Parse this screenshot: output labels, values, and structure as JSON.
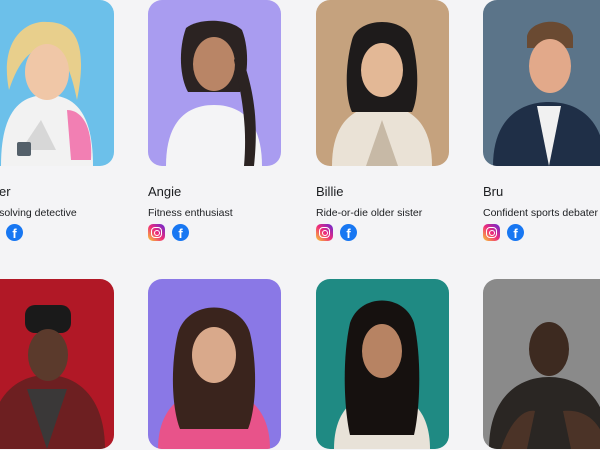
{
  "row1": [
    {
      "name": "mber",
      "description": "me-solving detective",
      "socials": [
        "facebook-icon"
      ]
    },
    {
      "name": "Angie",
      "description": "Fitness enthusiast",
      "socials": [
        "instagram-icon",
        "facebook-icon"
      ]
    },
    {
      "name": "Billie",
      "description": "Ride-or-die older sister",
      "socials": [
        "instagram-icon",
        "facebook-icon"
      ]
    },
    {
      "name": "Bru",
      "description": "Confident sports debater",
      "socials": [
        "instagram-icon",
        "facebook-icon"
      ]
    }
  ],
  "icons": {
    "facebook_glyph": "f"
  },
  "colors": {
    "bg1": "#6cc0ea",
    "bg2": "#a99cf0",
    "bg3": "#c5a27e",
    "bg4": "#5b7489",
    "bg5": "#b11826",
    "bg6": "#8a78e6",
    "bg7": "#1f8a83",
    "bg8": "#8a8a8a",
    "instagram": "#ee2a7b",
    "facebook": "#1877f2"
  }
}
